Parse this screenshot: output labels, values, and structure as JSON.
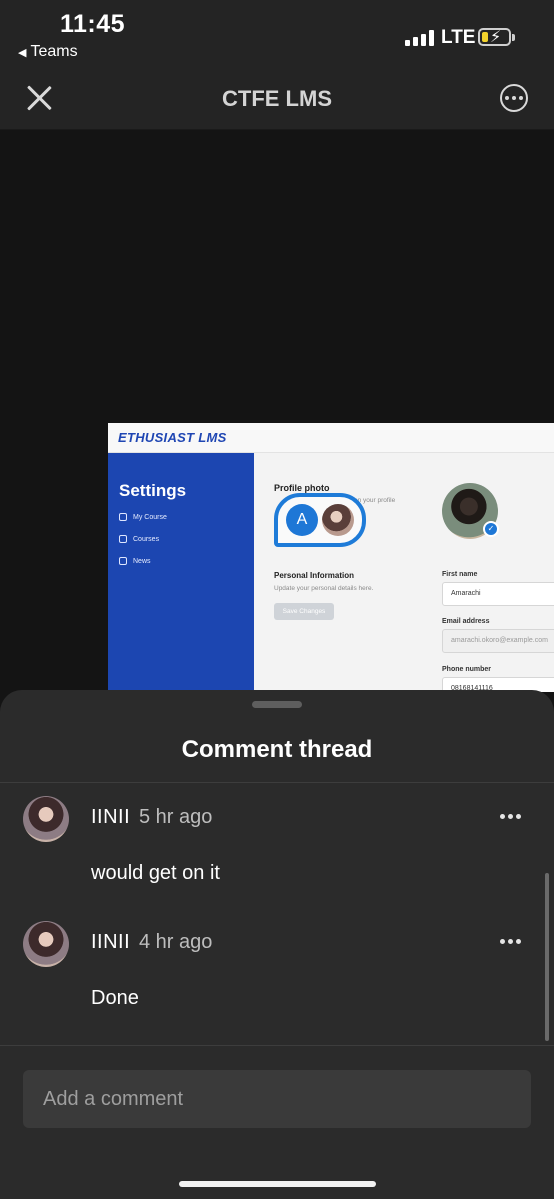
{
  "status_bar": {
    "time": "11:45",
    "back_app": "Teams",
    "network": "LTE"
  },
  "header": {
    "title": "CTFE LMS"
  },
  "shared_screen": {
    "logo": "ETHUSIAST LMS",
    "sidebar_title": "Settings",
    "sidebar_items": [
      "My Course",
      "Courses",
      "News"
    ],
    "profile_photo_title": "Profile photo",
    "profile_photo_sub": "on your profile",
    "cursor_initial": "A",
    "personal_info_title": "Personal Information",
    "personal_info_sub": "Update your personal details here.",
    "save_button": "Save Changes",
    "first_name_label": "First name",
    "first_name_value": "Amarachi",
    "email_label": "Email address",
    "email_value": "amarachi.okoro@example.com",
    "phone_label": "Phone number",
    "phone_value": "08168141116"
  },
  "comment_sheet": {
    "title": "Comment thread",
    "comments": [
      {
        "author": "IINII",
        "time": "5 hr ago",
        "text": "would get on it"
      },
      {
        "author": "IINII",
        "time": "4 hr ago",
        "text": "Done"
      }
    ],
    "compose_placeholder": "Add a comment"
  },
  "colors": {
    "sheet_bg": "#2b2b2b",
    "header_bg": "#242424",
    "sidebar_blue": "#1c46b1",
    "accent_blue": "#1e77d6"
  }
}
